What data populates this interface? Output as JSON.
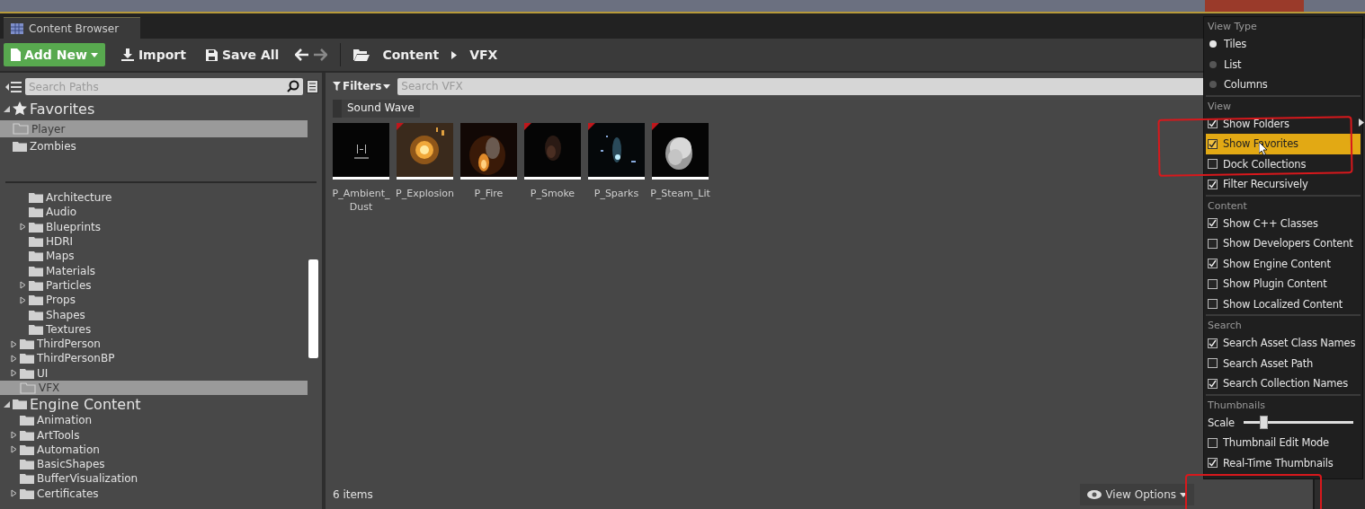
{
  "tab": {
    "title": "Content Browser"
  },
  "toolbar": {
    "add_new": "Add New",
    "import": "Import",
    "save_all": "Save All",
    "breadcrumbs": [
      "Content",
      "VFX"
    ]
  },
  "paths_search": {
    "placeholder": "Search Paths"
  },
  "favorites": {
    "title": "Favorites",
    "items": [
      {
        "label": "Player",
        "selected": true
      },
      {
        "label": "Zombies",
        "selected": false
      }
    ]
  },
  "tree": [
    {
      "children": [
        {
          "label": "Architecture",
          "expandable": false,
          "selected": false
        },
        {
          "label": "Audio",
          "expandable": false,
          "selected": false
        },
        {
          "label": "Blueprints",
          "expandable": true,
          "selected": false
        },
        {
          "label": "HDRI",
          "expandable": false,
          "selected": false
        },
        {
          "label": "Maps",
          "expandable": false,
          "selected": false
        },
        {
          "label": "Materials",
          "expandable": false,
          "selected": false
        },
        {
          "label": "Particles",
          "expandable": true,
          "selected": false
        },
        {
          "label": "Props",
          "expandable": true,
          "selected": false
        },
        {
          "label": "Shapes",
          "expandable": false,
          "selected": false
        },
        {
          "label": "Textures",
          "expandable": false,
          "selected": false
        }
      ]
    },
    {
      "label": "ThirdPerson",
      "expandable": true,
      "selected": false
    },
    {
      "label": "ThirdPersonBP",
      "expandable": true,
      "selected": false
    },
    {
      "label": "UI",
      "expandable": true,
      "selected": false
    },
    {
      "label": "VFX",
      "expandable": false,
      "selected": true
    }
  ],
  "engine_tree": {
    "title": "Engine Content",
    "children": [
      {
        "label": "Animation",
        "expandable": false,
        "selected": false
      },
      {
        "label": "ArtTools",
        "expandable": true,
        "selected": false
      },
      {
        "label": "Automation",
        "expandable": true,
        "selected": false
      },
      {
        "label": "BasicShapes",
        "expandable": false,
        "selected": false
      },
      {
        "label": "BufferVisualization",
        "expandable": false,
        "selected": false
      },
      {
        "label": "Certificates",
        "expandable": true,
        "selected": false
      }
    ]
  },
  "filters": {
    "label": "Filters",
    "placeholder": "Search VFX"
  },
  "filter_chips": [
    {
      "label": "Sound Wave"
    }
  ],
  "assets": [
    {
      "name": "P_Ambient_Dust",
      "flagged": false
    },
    {
      "name": "P_Explosion",
      "flagged": true
    },
    {
      "name": "P_Fire",
      "flagged": false
    },
    {
      "name": "P_Smoke",
      "flagged": true
    },
    {
      "name": "P_Sparks",
      "flagged": true
    },
    {
      "name": "P_Steam_Lit",
      "flagged": true
    }
  ],
  "status": {
    "count": "6 items"
  },
  "view_options": {
    "label": "View Options"
  },
  "menu": {
    "sections": [
      {
        "title": "View Type",
        "items": [
          {
            "kind": "radio",
            "label": "Tiles",
            "selected": true
          },
          {
            "kind": "radio",
            "label": "List",
            "selected": false
          },
          {
            "kind": "radio",
            "label": "Columns",
            "selected": false
          }
        ]
      },
      {
        "title": "View",
        "items": [
          {
            "kind": "check",
            "label": "Show Folders",
            "checked": true,
            "hovered": false,
            "submenu": true
          },
          {
            "kind": "check",
            "label": "Show Favorites",
            "checked": true,
            "hovered": true,
            "submenu": false
          },
          {
            "kind": "check",
            "label": "Dock Collections",
            "checked": false,
            "hovered": false,
            "submenu": false
          },
          {
            "kind": "check",
            "label": "Filter Recursively",
            "checked": true,
            "hovered": false,
            "submenu": false
          }
        ]
      },
      {
        "title": "Content",
        "items": [
          {
            "kind": "check",
            "label": "Show C++ Classes",
            "checked": true,
            "hovered": false,
            "submenu": false
          },
          {
            "kind": "check",
            "label": "Show Developers Content",
            "checked": false,
            "hovered": false,
            "submenu": false
          },
          {
            "kind": "check",
            "label": "Show Engine Content",
            "checked": true,
            "hovered": false,
            "submenu": false
          },
          {
            "kind": "check",
            "label": "Show Plugin Content",
            "checked": false,
            "hovered": false,
            "submenu": false
          },
          {
            "kind": "check",
            "label": "Show Localized Content",
            "checked": false,
            "hovered": false,
            "submenu": false
          }
        ]
      },
      {
        "title": "Search",
        "items": [
          {
            "kind": "check",
            "label": "Search Asset Class Names",
            "checked": true,
            "hovered": false,
            "submenu": false
          },
          {
            "kind": "check",
            "label": "Search Asset Path",
            "checked": false,
            "hovered": false,
            "submenu": false
          },
          {
            "kind": "check",
            "label": "Search Collection Names",
            "checked": true,
            "hovered": false,
            "submenu": false
          }
        ]
      },
      {
        "title": "Thumbnails",
        "items": [
          {
            "kind": "slider",
            "label": "Scale",
            "level": 0.18
          },
          {
            "kind": "check",
            "label": "Thumbnail Edit Mode",
            "checked": false,
            "hovered": false,
            "submenu": false
          },
          {
            "kind": "check",
            "label": "Real-Time Thumbnails",
            "checked": true,
            "hovered": false,
            "submenu": false
          }
        ]
      }
    ]
  }
}
